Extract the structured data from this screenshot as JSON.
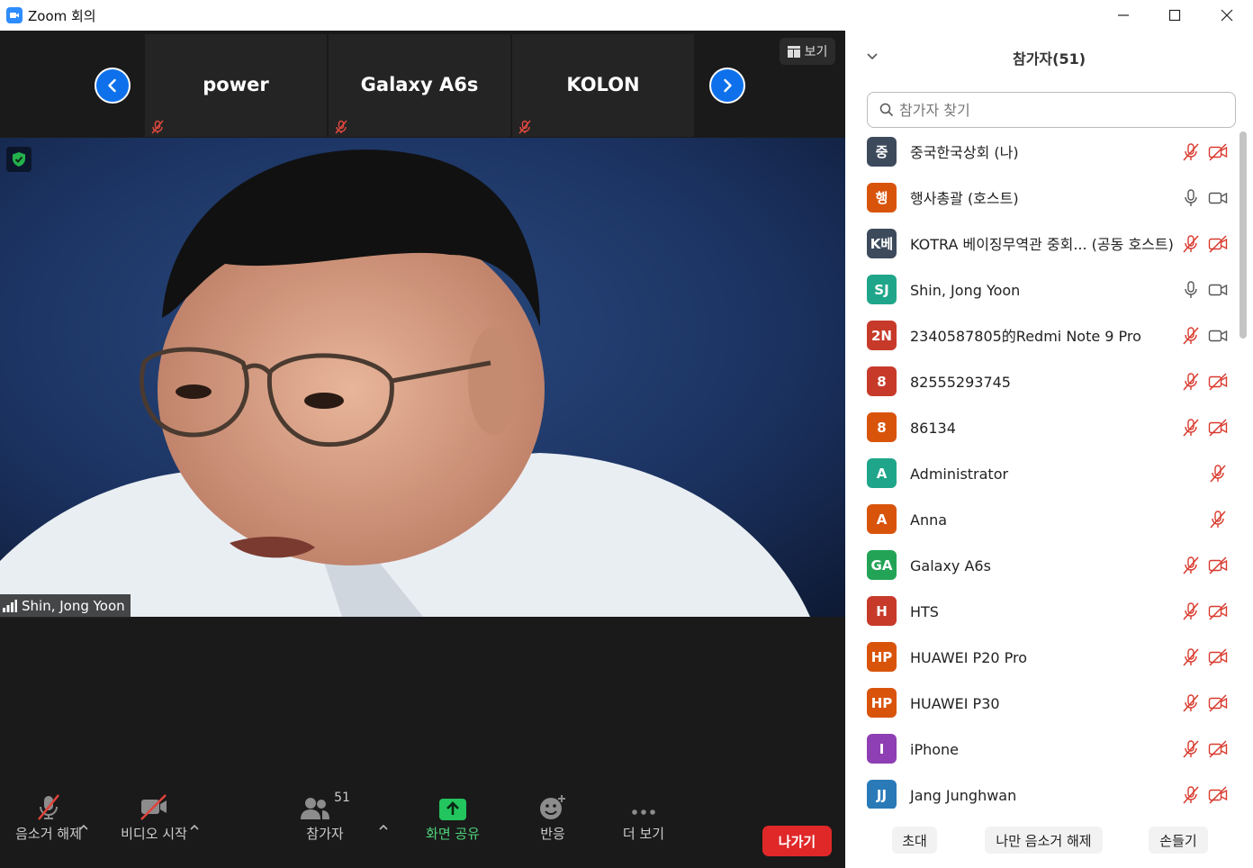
{
  "window": {
    "title": "Zoom 회의"
  },
  "strip": {
    "thumbnails": [
      {
        "name": "power",
        "muted": true
      },
      {
        "name": "Galaxy A6s",
        "muted": true
      },
      {
        "name": "KOLON",
        "muted": true
      }
    ],
    "view_label": "보기"
  },
  "video": {
    "speaker_name": "Shin, Jong Yoon"
  },
  "toolbar": {
    "unmute_label": "음소거 해제",
    "video_label": "비디오 시작",
    "participants_label": "참가자",
    "participants_count": "51",
    "share_label": "화면 공유",
    "reactions_label": "반응",
    "more_label": "더 보기",
    "leave_label": "나가기"
  },
  "panel": {
    "title": "참가자(51)",
    "search_placeholder": "참가자 찾기",
    "participants": [
      {
        "initials": "중",
        "name": "중국한국상회 (나)",
        "color": "#3d4a5c",
        "mic": "muted",
        "video": "off"
      },
      {
        "initials": "행",
        "name": "행사총괄 (호스트)",
        "color": "#d9540b",
        "mic": "on",
        "video": "on"
      },
      {
        "initials": "K베",
        "name": "KOTRA 베이징무역관 중회...  (공동 호스트)",
        "color": "#3d4a5c",
        "mic": "muted",
        "video": "off"
      },
      {
        "initials": "SJ",
        "name": "Shin, Jong Yoon",
        "color": "#1fa68a",
        "mic": "on",
        "video": "on"
      },
      {
        "initials": "2N",
        "name": "2340587805的Redmi Note 9 Pro",
        "color": "#c73a2a",
        "mic": "muted",
        "video": "on"
      },
      {
        "initials": "8",
        "name": "82555293745",
        "color": "#c73a2a",
        "mic": "muted",
        "video": "off"
      },
      {
        "initials": "8",
        "name": "86134",
        "color": "#d9540b",
        "mic": "muted",
        "video": "off"
      },
      {
        "initials": "A",
        "name": "Administrator",
        "color": "#1fa68a",
        "mic": "muted",
        "video": "none"
      },
      {
        "initials": "A",
        "name": "Anna",
        "color": "#d9540b",
        "mic": "muted",
        "video": "none"
      },
      {
        "initials": "GA",
        "name": "Galaxy A6s",
        "color": "#22a356",
        "mic": "muted",
        "video": "off"
      },
      {
        "initials": "H",
        "name": "HTS",
        "color": "#c73a2a",
        "mic": "muted",
        "video": "off"
      },
      {
        "initials": "HP",
        "name": "HUAWEI P20 Pro",
        "color": "#d9540b",
        "mic": "muted",
        "video": "off"
      },
      {
        "initials": "HP",
        "name": "HUAWEI P30",
        "color": "#d9540b",
        "mic": "muted",
        "video": "off"
      },
      {
        "initials": "I",
        "name": "iPhone",
        "color": "#8e3fb3",
        "mic": "muted",
        "video": "off"
      },
      {
        "initials": "JJ",
        "name": "Jang Junghwan",
        "color": "#2a7ab8",
        "mic": "muted",
        "video": "off"
      }
    ],
    "footer": {
      "invite_label": "초대",
      "unmute_me_label": "나만 음소거 해제",
      "raise_hand_label": "손들기"
    }
  },
  "colors": {
    "accent": "#0e71eb",
    "leave": "#e02828",
    "share": "#22c55e",
    "muted_icon": "#d93a2e"
  }
}
